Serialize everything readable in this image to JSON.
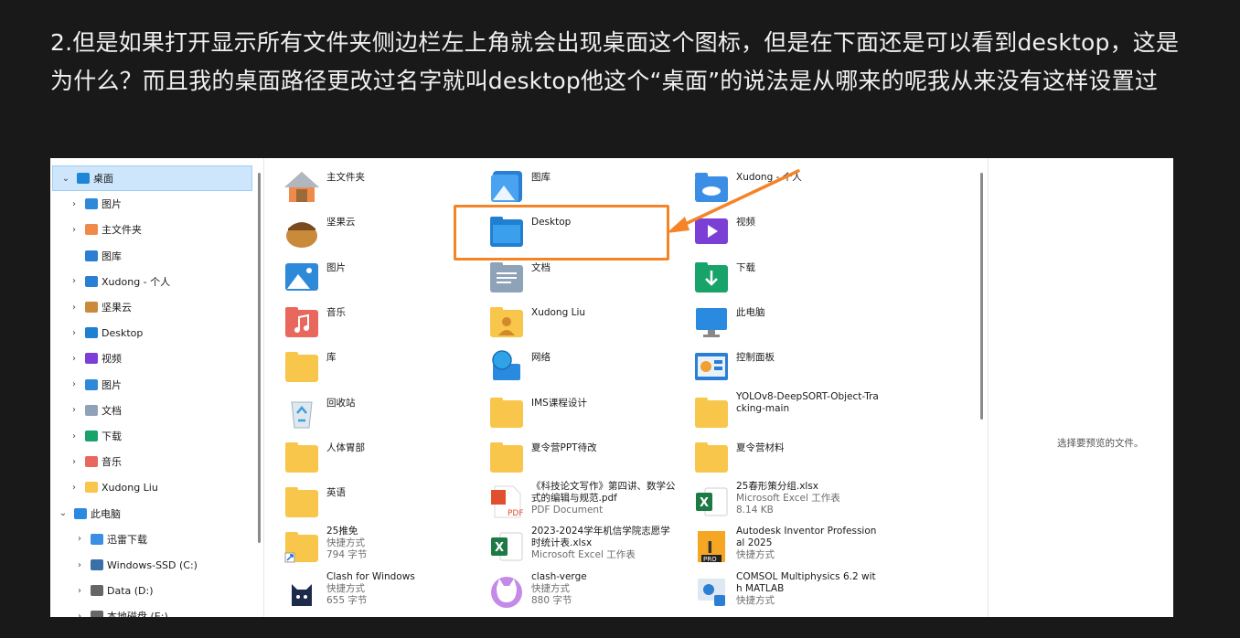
{
  "question": "2.但是如果打开显示所有文件夹侧边栏左上角就会出现桌面这个图标，但是在下面还是可以看到desktop，这是为什么？而且我的桌面路径更改过名字就叫desktop他这个“桌面”的说法是从哪来的呢我从来没有这样设置过",
  "nav": [
    {
      "label": "桌面",
      "icon": "desktop-icon",
      "expanded": true,
      "selected": true
    },
    {
      "label": "图片",
      "icon": "pictures-icon"
    },
    {
      "label": "主文件夹",
      "icon": "home-icon"
    },
    {
      "label": "图库",
      "icon": "gallery-icon"
    },
    {
      "label": "Xudong - 个人",
      "icon": "onedrive-icon"
    },
    {
      "label": "坚果云",
      "icon": "nutstore-icon"
    },
    {
      "label": "Desktop",
      "icon": "desktop-folder-icon"
    },
    {
      "label": "视频",
      "icon": "videos-icon"
    },
    {
      "label": "图片",
      "icon": "pictures-icon"
    },
    {
      "label": "文档",
      "icon": "documents-icon"
    },
    {
      "label": "下载",
      "icon": "downloads-icon"
    },
    {
      "label": "音乐",
      "icon": "music-icon"
    },
    {
      "label": "Xudong Liu",
      "icon": "user-folder-icon"
    },
    {
      "label": "此电脑",
      "icon": "this-pc-icon",
      "expanded": true
    },
    {
      "label": "迅雷下载",
      "icon": "thunder-icon"
    },
    {
      "label": "Windows-SSD (C:)",
      "icon": "drive-c-icon"
    },
    {
      "label": "Data (D:)",
      "icon": "drive-d-icon"
    },
    {
      "label": "本地磁盘 (E:)",
      "icon": "drive-e-icon"
    }
  ],
  "items": [
    {
      "name": "主文件夹",
      "icon": "home-icon"
    },
    {
      "name": "图库",
      "icon": "gallery-icon"
    },
    {
      "name": "Xudong - 个人",
      "icon": "onedrive-folder-icon"
    },
    {
      "name": "坚果云",
      "icon": "nutstore-icon"
    },
    {
      "name": "Desktop",
      "icon": "desktop-folder-icon"
    },
    {
      "name": "视频",
      "icon": "videos-icon"
    },
    {
      "name": "图片",
      "icon": "pictures-icon"
    },
    {
      "name": "文档",
      "icon": "documents-icon"
    },
    {
      "name": "下载",
      "icon": "downloads-icon"
    },
    {
      "name": "音乐",
      "icon": "music-icon"
    },
    {
      "name": "Xudong Liu",
      "icon": "user-folder-icon"
    },
    {
      "name": "此电脑",
      "icon": "this-pc-icon"
    },
    {
      "name": "库",
      "icon": "libraries-icon"
    },
    {
      "name": "网络",
      "icon": "network-icon"
    },
    {
      "name": "控制面板",
      "icon": "control-panel-icon"
    },
    {
      "name": "回收站",
      "icon": "recycle-bin-icon"
    },
    {
      "name": "IMS课程设计",
      "icon": "folder-icon"
    },
    {
      "name": "YOLOv8-DeepSORT-Object-Tracking-main",
      "icon": "folder-icon"
    },
    {
      "name": "人体胃部",
      "icon": "folder-icon"
    },
    {
      "name": "夏令营PPT待改",
      "icon": "folder-icon"
    },
    {
      "name": "夏令营材料",
      "icon": "folder-icon"
    },
    {
      "name": "英语",
      "icon": "folder-icon"
    },
    {
      "name": "《科技论文写作》第四讲、数学公式的编辑与规范.pdf",
      "sub1": "PDF Document",
      "icon": "pdf-icon"
    },
    {
      "name": "25春形策分组.xlsx",
      "sub1": "Microsoft Excel 工作表",
      "sub2": "8.14 KB",
      "icon": "excel-icon"
    },
    {
      "name": "25推免",
      "sub1": "快捷方式",
      "sub2": "794 字节",
      "icon": "shortcut-folder-icon"
    },
    {
      "name": "2023-2024学年机信学院志愿学时统计表.xlsx",
      "sub1": "Microsoft Excel 工作表",
      "icon": "excel-icon"
    },
    {
      "name": "Autodesk Inventor Professional 2025",
      "sub1": "快捷方式",
      "icon": "inventor-icon"
    },
    {
      "name": "Clash for Windows",
      "sub1": "快捷方式",
      "sub2": "655 字节",
      "icon": "clash-icon"
    },
    {
      "name": "clash-verge",
      "sub1": "快捷方式",
      "sub2": "880 字节",
      "icon": "clash-verge-icon"
    },
    {
      "name": "COMSOL Multiphysics 6.2 with MATLAB",
      "sub1": "快捷方式",
      "icon": "comsol-icon"
    }
  ],
  "preview_empty": "选择要预览的文件。",
  "colors": {
    "background": "#191919",
    "highlight": "#f58426",
    "folder": "#f8c64a",
    "selection": "#cde6fb"
  }
}
